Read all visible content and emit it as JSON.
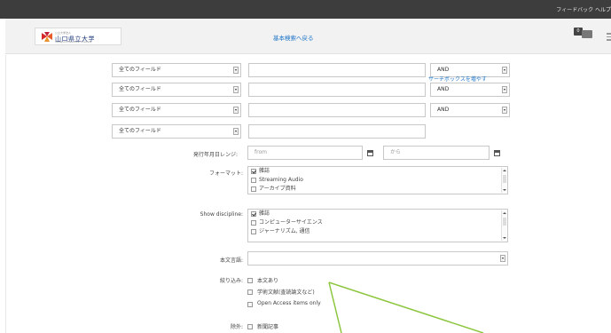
{
  "topbar": {
    "links": "フィードバック  ヘルプ"
  },
  "header": {
    "logo_sub": "公立大学法人",
    "logo_name": "山口県立大学",
    "logo_eng": "Yamaguchi Prefectural University",
    "back_link": "基本検索へ戻る",
    "badge_count": "0"
  },
  "search_rows": [
    {
      "field": "全てのフィールド",
      "operator": "AND"
    },
    {
      "field": "全てのフィールド",
      "operator": "AND"
    },
    {
      "field": "全てのフィールド",
      "operator": "AND"
    },
    {
      "field": "全てのフィールド"
    }
  ],
  "add_search_box": "サーチボックスを増やす",
  "date_range": {
    "label": "発行年月日レンジ:",
    "from_placeholder": "from",
    "to_placeholder": "から"
  },
  "format": {
    "label": "フォーマット:",
    "options": [
      {
        "label": "雑誌",
        "checked": true
      },
      {
        "label": "Streaming Audio",
        "checked": false
      },
      {
        "label": "アーカイブ資料",
        "checked": false
      }
    ]
  },
  "discipline": {
    "label": "Show discipline:",
    "options": [
      {
        "label": "雑誌",
        "checked": true
      },
      {
        "label": "コンピューターサイエンス",
        "checked": false
      },
      {
        "label": "ジャーナリズム, 通信",
        "checked": false
      }
    ]
  },
  "language": {
    "label": "本文言語:"
  },
  "refine": {
    "label": "絞り込み:",
    "options": [
      "本文あり",
      "学術文献(査読論文など)",
      "Open Access items only"
    ]
  },
  "exclude": {
    "label": "除外:",
    "options": [
      "新聞記事"
    ]
  },
  "annotation": {
    "color": "#8cc63f"
  }
}
